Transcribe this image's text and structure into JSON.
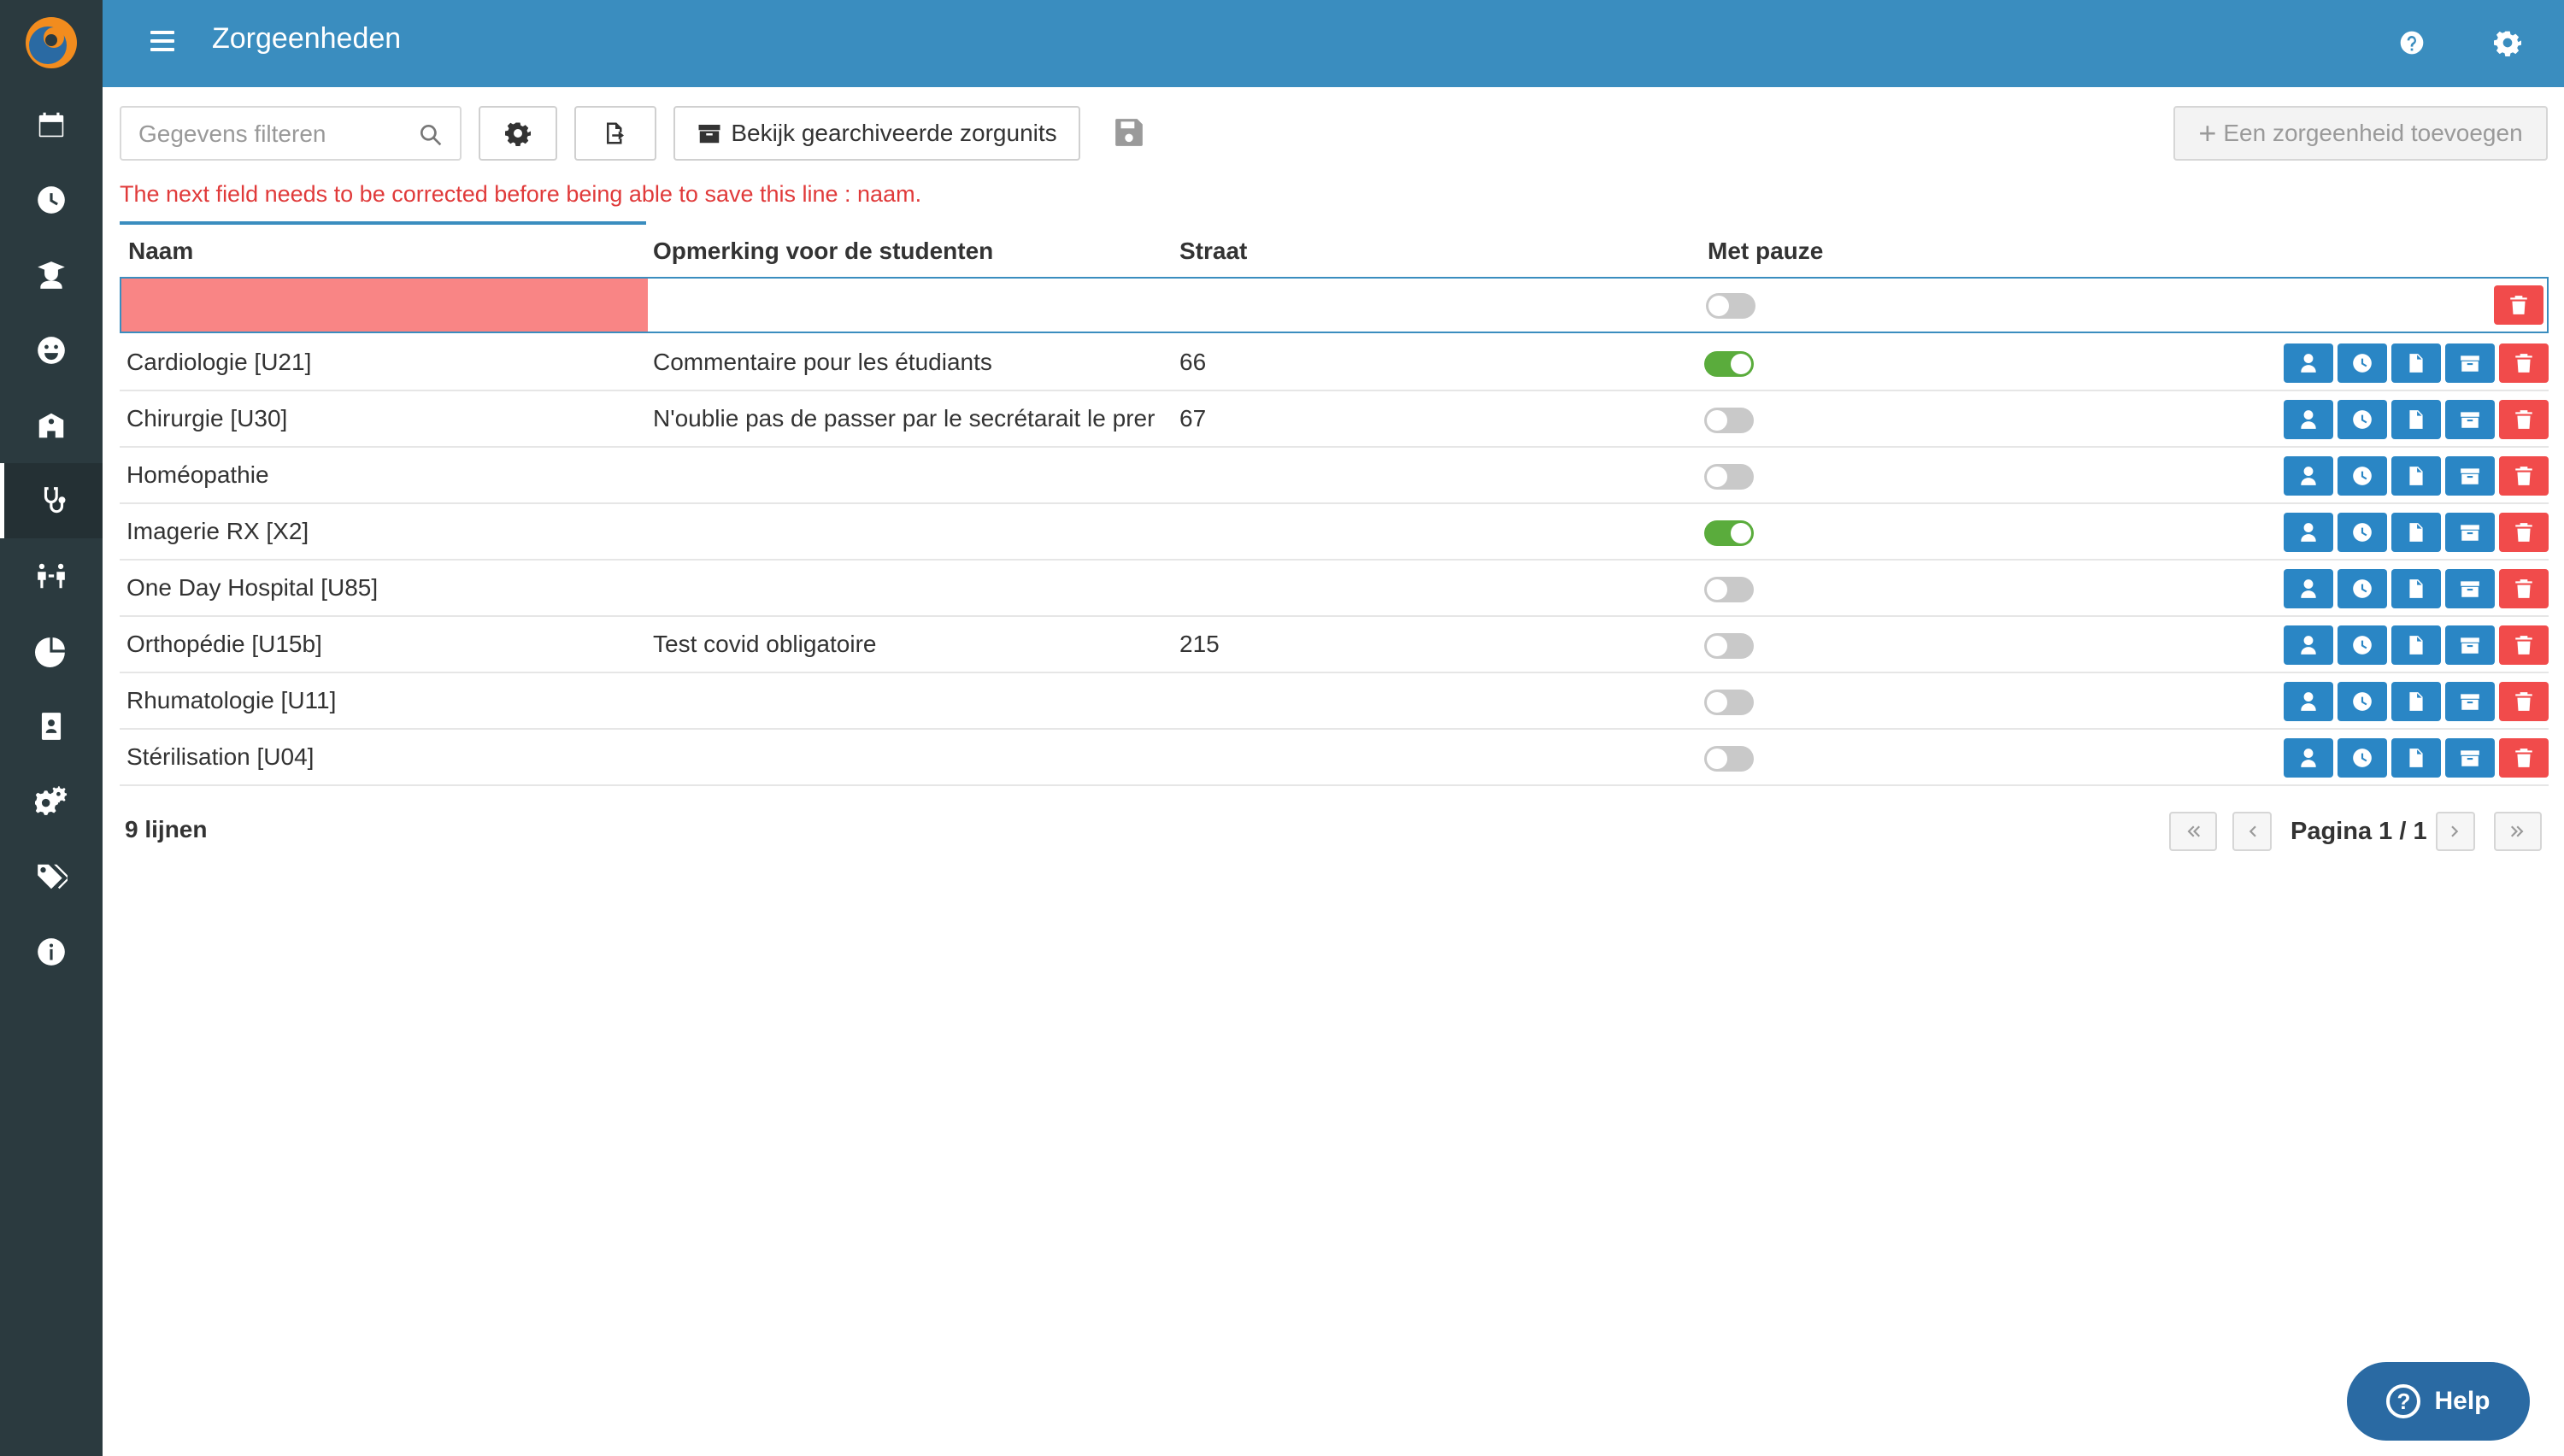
{
  "app": {
    "title": "Zorgeenheden"
  },
  "sidebar": {
    "items": [
      {
        "icon": "calendar-icon"
      },
      {
        "icon": "clock-icon"
      },
      {
        "icon": "graduate-icon"
      },
      {
        "icon": "smiley-icon"
      },
      {
        "icon": "school-icon"
      },
      {
        "icon": "stethoscope-icon",
        "active": true
      },
      {
        "icon": "people-link-icon"
      },
      {
        "icon": "pie-chart-icon"
      },
      {
        "icon": "id-badge-icon"
      },
      {
        "icon": "cogs-icon"
      },
      {
        "icon": "tags-icon"
      },
      {
        "icon": "info-icon"
      }
    ]
  },
  "toolbar": {
    "search_placeholder": "Gegevens filteren",
    "archived_label": "Bekijk gearchiveerde zorgunits",
    "add_label": "Een zorgeenheid toevoegen"
  },
  "error_message": "The next field needs to be corrected before being able to save this line : naam.",
  "table": {
    "headers": {
      "name": "Naam",
      "remark": "Opmerking voor de studenten",
      "street": "Straat",
      "pause": "Met pauze"
    },
    "edit_row": {
      "name": "",
      "remark": "",
      "street": "",
      "pause": false
    },
    "rows": [
      {
        "name": "Cardiologie [U21]",
        "remark": "Commentaire pour les étudiants",
        "street": "66",
        "pause": true
      },
      {
        "name": "Chirurgie [U30]",
        "remark": "N'oublie pas de passer par le secrétarait le prer",
        "street": "67",
        "pause": false
      },
      {
        "name": "Homéopathie",
        "remark": "",
        "street": "",
        "pause": false
      },
      {
        "name": "Imagerie RX [X2]",
        "remark": "",
        "street": "",
        "pause": true
      },
      {
        "name": "One Day Hospital [U85]",
        "remark": "",
        "street": "",
        "pause": false
      },
      {
        "name": "Orthopédie [U15b]",
        "remark": "Test covid obligatoire",
        "street": "215",
        "pause": false
      },
      {
        "name": "Rhumatologie [U11]",
        "remark": "",
        "street": "",
        "pause": false
      },
      {
        "name": "Stérilisation [U04]",
        "remark": "",
        "street": "",
        "pause": false
      }
    ]
  },
  "footer": {
    "count_label": "9 lijnen",
    "pager_label": "Pagina 1 / 1"
  },
  "help": {
    "label": "Help"
  },
  "colors": {
    "topbar": "#3a8dbf",
    "sidebar": "#2b3a3f",
    "action_blue": "#2a86c5",
    "danger": "#f14b4b",
    "toggle_on": "#5aac3c",
    "error_text": "#e03a3a"
  }
}
